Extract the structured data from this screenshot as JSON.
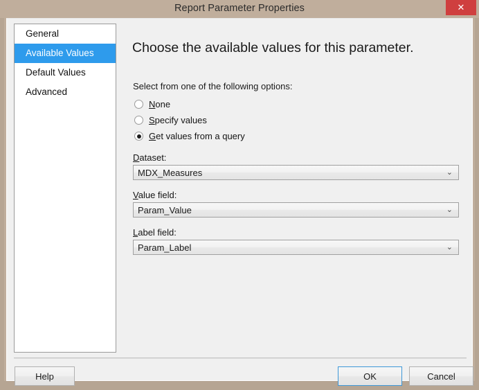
{
  "window": {
    "title": "Report Parameter Properties",
    "close_icon": "close-icon",
    "close_glyph": "✕",
    "titlebar_color": "#c0ae9c",
    "close_color": "#cf3f3f"
  },
  "sidebar": {
    "items": [
      {
        "label": "General",
        "selected": false
      },
      {
        "label": "Available Values",
        "selected": true
      },
      {
        "label": "Default Values",
        "selected": false
      },
      {
        "label": "Advanced",
        "selected": false
      }
    ],
    "selection_color": "#2e9bec"
  },
  "content": {
    "heading": "Choose the available values for this parameter.",
    "prompt": "Select from one of the following options:",
    "radio_options": [
      {
        "accel": "N",
        "rest": "one",
        "checked": false
      },
      {
        "accel": "S",
        "rest": "pecify values",
        "checked": false
      },
      {
        "accel": "G",
        "rest": "et values from a query",
        "checked": true
      }
    ],
    "fields": [
      {
        "label_accel": "D",
        "label_rest": "ataset:",
        "value": "MDX_Measures",
        "arrow_icon": "chevron-down-icon",
        "arrow_glyph": "⌄"
      },
      {
        "label_accel": "V",
        "label_rest": "alue field:",
        "value": "Param_Value",
        "arrow_icon": "chevron-down-icon",
        "arrow_glyph": "⌄"
      },
      {
        "label_accel": "L",
        "label_rest": "abel field:",
        "value": "Param_Label",
        "arrow_icon": "chevron-down-icon",
        "arrow_glyph": "⌄"
      }
    ]
  },
  "footer": {
    "help_label": "Help",
    "ok_label": "OK",
    "cancel_label": "Cancel",
    "default_button_border": "#3c97d8"
  }
}
